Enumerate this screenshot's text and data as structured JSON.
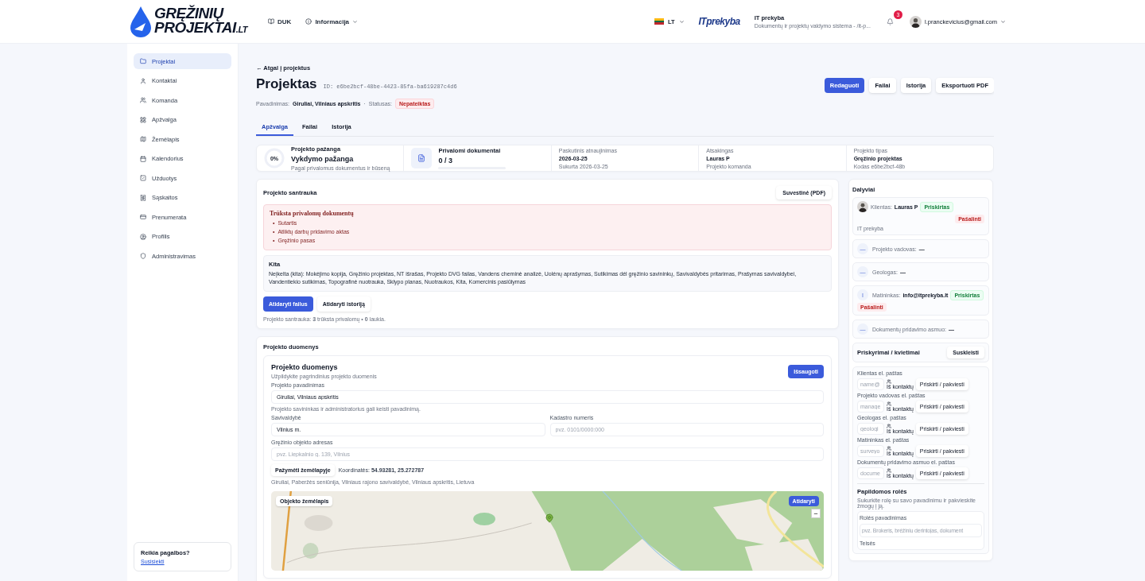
{
  "header": {
    "logo": {
      "line1": "GRĘŽINIŲ",
      "line2": "PROJEKTAI",
      "suffix": ".LT"
    },
    "nav": [
      {
        "label": "DUK",
        "kind": "book"
      },
      {
        "label": "Informacija",
        "kind": "info"
      }
    ],
    "language": "LT",
    "partner_logo": "ITprekyba",
    "company": {
      "name": "IT prekyba",
      "subtitle": "Dokumentų ir projektų valdymo sistema - /it-p..."
    },
    "notifications": "3",
    "user": "l.pranckevicius@gmail.com"
  },
  "sidebar": {
    "items": [
      {
        "label": "Projektai",
        "selected": true
      },
      {
        "label": "Kontaktai",
        "selected": false
      },
      {
        "label": "Komanda",
        "selected": false
      },
      {
        "label": "Apžvalga",
        "selected": false
      },
      {
        "label": "Žemėlapis",
        "selected": false
      },
      {
        "label": "Kalendorius",
        "selected": false
      },
      {
        "label": "Užduotys",
        "selected": false
      },
      {
        "label": "Sąskaitos",
        "selected": false
      },
      {
        "label": "Prenumerata",
        "selected": false
      },
      {
        "label": "Profilis",
        "selected": false
      },
      {
        "label": "Administravimas",
        "selected": false
      }
    ],
    "help": {
      "title": "Reikia pagalbos?",
      "link": "Susisiekti"
    }
  },
  "page": {
    "back": "← Atgal į projektus",
    "title": "Projektas",
    "id_label": "ID:",
    "id": "e6be2bcf-48be-4423-85fa-ba619287c4d6",
    "name_label": "Pavadinimas:",
    "name": "Giruliai, Vilniaus apskritis",
    "separator": "·",
    "status_label": "Statusas:",
    "status": "Nepateiktas",
    "actions": [
      {
        "label": "Redaguoti",
        "kind": "primary"
      },
      {
        "label": "Failai",
        "kind": "secondary"
      },
      {
        "label": "Istorija",
        "kind": "secondary"
      },
      {
        "label": "Eksportuoti PDF",
        "kind": "secondary"
      }
    ],
    "tabs": [
      {
        "label": "Apžvalga",
        "selected": true
      },
      {
        "label": "Failai",
        "selected": false
      },
      {
        "label": "Istorija",
        "selected": false
      }
    ]
  },
  "stats": {
    "progress": {
      "title": "Projekto pažanga",
      "value": "Vykdymo pažanga",
      "subtitle": "Pagal privalomus dokumentus ir būseną",
      "percent": "0%",
      "level": 0
    },
    "documents": {
      "title": "Privalomi dokumentai",
      "value": "0 / 3",
      "level": 0
    },
    "cards": [
      {
        "label": "Paskutinis atnaujinimas",
        "value": "2026-03-25",
        "sub": "Sukurta 2026-03-25"
      },
      {
        "label": "Atsakingas",
        "value": "Lauras P",
        "sub": "Projekto komanda"
      },
      {
        "label": "Projekto tipas",
        "value": "Gręžinio projektas",
        "sub": "Kodas e6be2bcf-48b"
      }
    ]
  },
  "summary": {
    "title": "Projekto santrauka",
    "pdf_button": "Suvestinė (PDF)",
    "alert": {
      "title": "Trūksta privalomų dokumentų",
      "marker": "•",
      "items": [
        "Sutartis",
        "Atliktų darbų pridavimo aktas",
        "Gręžinio pasas"
      ]
    },
    "other": {
      "title": "Kita",
      "text": "Neįkelta (kita): Mokėjimo kopija, Gręžinio projektas, NT išrašas, Projekto DVG failas, Vandens cheminė analizė, Uolėnų aprašymas, Sutikimas dėl gręžinio savininkų, Savivaldybės pritarimas, Prašymas savivaldybei, Vandentiekio sutikimas, Topografinė nuotrauka, Sklypo planas, Nuotraukos, Kita, Komercinis pasiūlymas"
    },
    "buttons": [
      {
        "label": "Atidaryti failus",
        "kind": "primary"
      },
      {
        "label": "Atidaryti istoriją",
        "kind": "secondary"
      }
    ],
    "footer": "Projekto santrauka: **3** trūksta privalomų • **0** laukia."
  },
  "project_data": {
    "section_title": "Projekto duomenys",
    "title": "Projekto duomenys",
    "subtitle": "Užpildykite pagrindinius projekto duomenis",
    "save": "Išsaugoti",
    "rows": [
      [
        {
          "label": "Projekto pavadinimas",
          "value": "Giruliai, Vilniaus apskritis",
          "hint": "Projekto savininkas ir administratorius gali keisti pavadinimą."
        }
      ],
      [
        {
          "label": "Savivaldybė",
          "value": "Vilnius m."
        },
        {
          "label": "Kadastro numeris",
          "placeholder": "pvz. 0101/0000:000"
        }
      ],
      [
        {
          "label": "Gręžinio objekto adresas",
          "placeholder": "pvz. Liepkalnio g. 139, Vilnius"
        }
      ]
    ],
    "map_button": "Pažymėti žemėlapyje",
    "coordinates": "Koordinatės: **54.93281, 25.272787**",
    "address": "Giruliai, Paberžės seniūnija, Vilniaus rajono savivaldybė, Vilniaus apskritis, Lietuva",
    "map": {
      "kind": "picture",
      "label": "Objekto žemėlapis",
      "open": "Atidaryti",
      "zoom_out": "−"
    }
  },
  "participants": {
    "title": "Dalyviai",
    "items": [
      {
        "role": "Klientas:",
        "value": "Lauras P",
        "assigned": "Priskirtas",
        "remove": "Pašalinti",
        "sub": "IT prekyba"
      },
      {
        "kind": "initial",
        "initial": "—",
        "role": "Projekto vadovas:",
        "value": "—"
      },
      {
        "kind": "initial",
        "initial": "—",
        "role": "Geologas:",
        "value": "—"
      },
      {
        "kind": "initial",
        "initial": "I",
        "role": "Matininkas:",
        "value": "info@itprekyba.lt",
        "assigned": "Priskirtas",
        "remove": "Pašalinti"
      },
      {
        "kind": "initial",
        "initial": "—",
        "role": "Dokumentų pridavimo asmuo:",
        "value": "—"
      }
    ]
  },
  "assign": {
    "title": "Priskyrimai / kvietimai",
    "toggle": "Suskleisti",
    "rows": [
      {
        "label": "Klientas el. paštas",
        "placeholder": "name@",
        "contacts": "Iš kontaktų",
        "button": "Priskirti / pakviesti"
      },
      {
        "label": "Projekto vadovas el. paštas",
        "placeholder": "manage",
        "contacts": "Iš kontaktų",
        "button": "Priskirti / pakviesti"
      },
      {
        "label": "Geologas el. paštas",
        "placeholder": "geologi",
        "contacts": "Iš kontaktų",
        "button": "Priskirti / pakviesti"
      },
      {
        "label": "Matininkas el. paštas",
        "placeholder": "surveyo",
        "contacts": "Iš kontaktų",
        "button": "Priskirti / pakviesti"
      },
      {
        "label": "Dokumentų pridavimo asmuo el. paštas",
        "placeholder": "docume",
        "contacts": "Iš kontaktų",
        "button": "Priskirti / pakviesti"
      }
    ],
    "extra": {
      "title": "Papildomos rolės",
      "subtitle": "Sukurkite rolę su savo pavadinimu ir pakvieskite žmogų į ją.",
      "field_label": "Rolės pavadinimas",
      "placeholder": "pvz. Brokeris, brėžinių derintojas, dokument",
      "next_label": "Teisės"
    }
  }
}
